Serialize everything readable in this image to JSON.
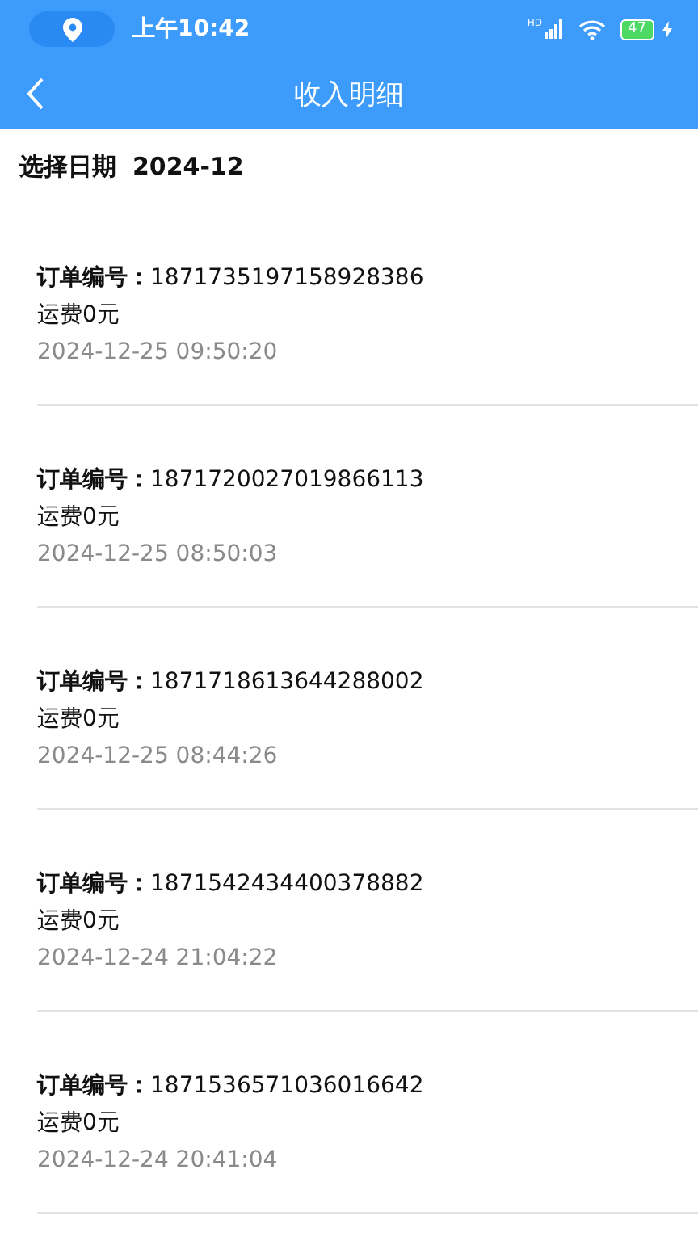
{
  "status_bar": {
    "time": "上午10:42",
    "signal_label": "HD",
    "battery": "47"
  },
  "header": {
    "title": "收入明细"
  },
  "date_filter": {
    "label": "选择日期",
    "value": "2024-12"
  },
  "orders": [
    {
      "label": "订单编号：",
      "number": "1871735197158928386",
      "fee": "运费0元",
      "time": "2024-12-25 09:50:20"
    },
    {
      "label": "订单编号：",
      "number": "1871720027019866113",
      "fee": "运费0元",
      "time": "2024-12-25 08:50:03"
    },
    {
      "label": "订单编号：",
      "number": "1871718613644288002",
      "fee": "运费0元",
      "time": "2024-12-25 08:44:26"
    },
    {
      "label": "订单编号：",
      "number": "1871542434400378882",
      "fee": "运费0元",
      "time": "2024-12-24 21:04:22"
    },
    {
      "label": "订单编号：",
      "number": "1871536571036016642",
      "fee": "运费0元",
      "time": "2024-12-24 20:41:04"
    }
  ]
}
